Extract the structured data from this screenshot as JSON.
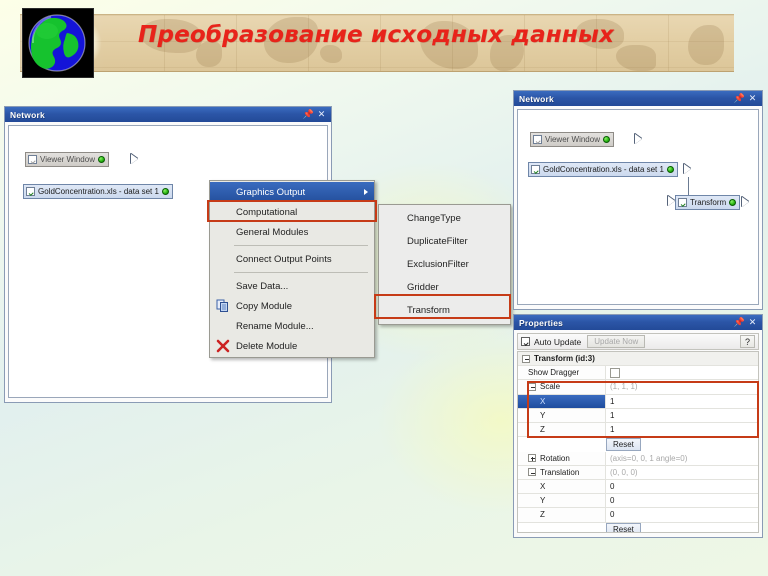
{
  "slide": {
    "title": "Преобразование исходных данных",
    "title_color": "#e8231a",
    "banner_color": "#e3cfa5",
    "globe_icon": "globe-icon"
  },
  "left_window": {
    "title": "Network",
    "pin_icon": "pin-icon",
    "close_icon": "close-icon",
    "nodes": [
      {
        "label": "Viewer Window",
        "checked": false,
        "state": "dim",
        "port_icon": "output-port-icon",
        "status_icon": "green-status-dot"
      },
      {
        "label": "GoldConcentration.xls - data set 1",
        "checked": true,
        "state": "selected",
        "port_icon": "output-port-icon",
        "status_icon": "green-status-dot"
      }
    ]
  },
  "context_menu": {
    "items": [
      {
        "label": "Graphics Output",
        "highlighted": true,
        "submenu": true,
        "icon": null,
        "separator_after": false
      },
      {
        "label": "Computational",
        "highlighted": false,
        "submenu": true,
        "icon": null,
        "separator_after": false
      },
      {
        "label": "General Modules",
        "highlighted": false,
        "submenu": true,
        "icon": null,
        "separator_after": true
      },
      {
        "label": "Connect Output Points",
        "highlighted": false,
        "submenu": false,
        "icon": null,
        "separator_after": true
      },
      {
        "label": "Save Data...",
        "highlighted": false,
        "submenu": false,
        "icon": null,
        "separator_after": false
      },
      {
        "label": "Copy Module",
        "highlighted": false,
        "submenu": false,
        "icon": "copy-icon",
        "separator_after": false
      },
      {
        "label": "Rename Module...",
        "highlighted": false,
        "submenu": false,
        "icon": null,
        "separator_after": false
      },
      {
        "label": "Delete Module",
        "highlighted": false,
        "submenu": false,
        "icon": "delete-x-icon",
        "separator_after": false
      }
    ],
    "highlight_box_label": "Computational"
  },
  "submenu": {
    "items": [
      {
        "label": "ChangeType"
      },
      {
        "label": "DuplicateFilter"
      },
      {
        "label": "ExclusionFilter"
      },
      {
        "label": "Gridder"
      },
      {
        "label": "Transform"
      }
    ],
    "highlight_box_label": "Transform"
  },
  "right_window": {
    "title": "Network",
    "pin_icon": "pin-icon",
    "close_icon": "close-icon",
    "nodes": [
      {
        "label": "Viewer Window",
        "checked": false,
        "state": "dim"
      },
      {
        "label": "GoldConcentration.xls - data set 1",
        "checked": true,
        "state": "selected"
      },
      {
        "label": "Transform",
        "checked": true,
        "state": "selected"
      }
    ]
  },
  "properties": {
    "title": "Properties",
    "pin_icon": "pin-icon",
    "close_icon": "close-icon",
    "auto_update_label": "Auto Update",
    "auto_update_checked": true,
    "update_now_label": "Update Now",
    "update_now_enabled": false,
    "help_label": "?",
    "group_label": "Transform (id:3)",
    "rows": [
      {
        "name": "Show Dragger",
        "value": "",
        "indent": 1,
        "kind": "checkbox",
        "checked": false,
        "grey": false,
        "selected": false
      },
      {
        "name": "Scale",
        "value": "(1, 1, 1)",
        "indent": 1,
        "kind": "expander-minus",
        "grey": true,
        "selected": false
      },
      {
        "name": "X",
        "value": "1",
        "indent": 2,
        "kind": "value",
        "grey": false,
        "selected": true
      },
      {
        "name": "Y",
        "value": "1",
        "indent": 2,
        "kind": "value",
        "grey": false,
        "selected": false
      },
      {
        "name": "Z",
        "value": "1",
        "indent": 2,
        "kind": "value",
        "grey": false,
        "selected": false
      },
      {
        "name": "__reset__",
        "value": "Reset",
        "indent": 0,
        "kind": "reset",
        "grey": false,
        "selected": false
      },
      {
        "name": "Rotation",
        "value": "(axis=0, 0, 1  angle=0)",
        "indent": 1,
        "kind": "expander-plus",
        "grey": true,
        "selected": false
      },
      {
        "name": "Translation",
        "value": "(0, 0, 0)",
        "indent": 1,
        "kind": "expander-minus",
        "grey": true,
        "selected": false
      },
      {
        "name": "X",
        "value": "0",
        "indent": 2,
        "kind": "value",
        "grey": false,
        "selected": false
      },
      {
        "name": "Y",
        "value": "0",
        "indent": 2,
        "kind": "value",
        "grey": false,
        "selected": false
      },
      {
        "name": "Z",
        "value": "0",
        "indent": 2,
        "kind": "value",
        "grey": false,
        "selected": false
      },
      {
        "name": "__reset__",
        "value": "Reset",
        "indent": 0,
        "kind": "reset",
        "grey": false,
        "selected": false
      }
    ],
    "reset_label": "Reset",
    "highlight_box_rows": "Scale / X / Y / Z"
  },
  "annotation_color": "#c63b17"
}
